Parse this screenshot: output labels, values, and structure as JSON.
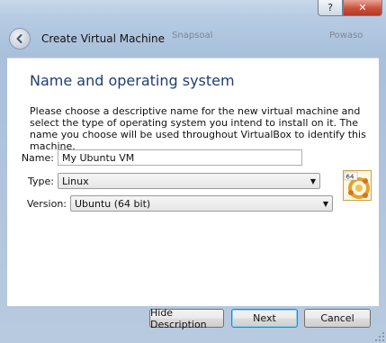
{
  "window": {
    "help_label": "?",
    "close_label": "✕"
  },
  "header": {
    "title": "Create Virtual Machine",
    "ghost_a": "Snapsoal",
    "ghost_b": "Powaso"
  },
  "page": {
    "title": "Name and operating system",
    "description": "Please choose a descriptive name for the new virtual machine and select the type of operating system you intend to install on it. The name you choose will be used throughout VirtualBox to identify this machine."
  },
  "form": {
    "name_label": "Name:",
    "name_value": "My Ubuntu VM",
    "type_label": "Type:",
    "type_value": "Linux",
    "version_label": "Version:",
    "version_value": "Ubuntu (64 bit)",
    "os_badge": "64"
  },
  "buttons": {
    "hide_description": "Hide Description",
    "next": "Next",
    "cancel": "Cancel"
  },
  "colors": {
    "title_blue": "#1e3d73",
    "close_red": "#c9503a",
    "frame_blue": "#b7cbe3"
  }
}
